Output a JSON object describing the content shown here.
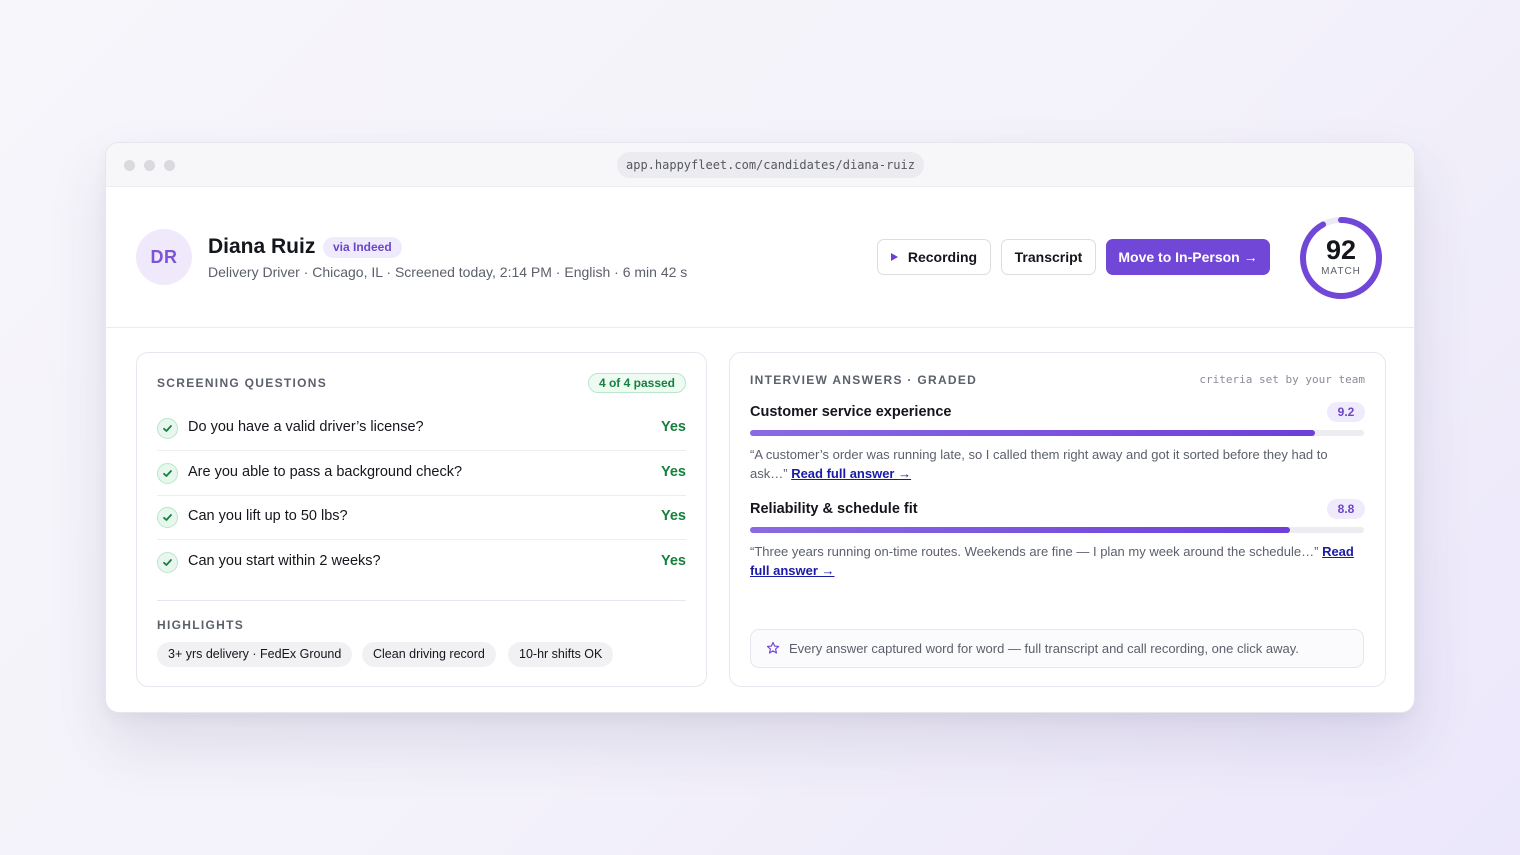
{
  "browser": {
    "url": "app.happyfleet.com/candidates/diana-ruiz"
  },
  "candidate": {
    "initials": "DR",
    "name": "Diana Ruiz",
    "source": "via Indeed",
    "meta": "Delivery Driver · Chicago, IL · Screened today, 2:14 PM · English · 6 min 42 s"
  },
  "actions": {
    "recording": "Recording",
    "transcript": "Transcript",
    "move": "Move to In-Person →"
  },
  "score": {
    "value": "92",
    "label": "MATCH",
    "percent": 92,
    "color": "#7047d6"
  },
  "screening": {
    "title": "SCREENING QUESTIONS",
    "badge": "4 of 4 passed",
    "questions": [
      {
        "text": "Do you have a valid driver’s license?",
        "answer": "Yes"
      },
      {
        "text": "Are you able to pass a background check?",
        "answer": "Yes"
      },
      {
        "text": "Can you lift up to 50 lbs?",
        "answer": "Yes"
      },
      {
        "text": "Can you start within 2 weeks?",
        "answer": "Yes"
      }
    ],
    "highlights_title": "HIGHLIGHTS",
    "highlights": [
      "3+ yrs delivery · FedEx Ground",
      "Clean driving record",
      "10-hr shifts OK"
    ]
  },
  "interview": {
    "title": "INTERVIEW ANSWERS · GRADED",
    "criteria": "criteria set by your team",
    "answers": [
      {
        "title": "Customer service experience",
        "score": "9.2",
        "fill": 0.92,
        "quote": "“A customer’s order was running late, so I called them right away and got it sorted before they had to ask…”",
        "link": "Read full answer →"
      },
      {
        "title": "Reliability & schedule fit",
        "score": "8.8",
        "fill": 0.88,
        "quote": "“Three years running on-time routes. Weekends are fine — I plan my week around the schedule…”",
        "link": "Read full answer →"
      }
    ],
    "note": "Every answer captured word for word — full transcript and call recording, one click away."
  },
  "colors": {
    "accent": "#7047d6",
    "success": "#17803d"
  }
}
